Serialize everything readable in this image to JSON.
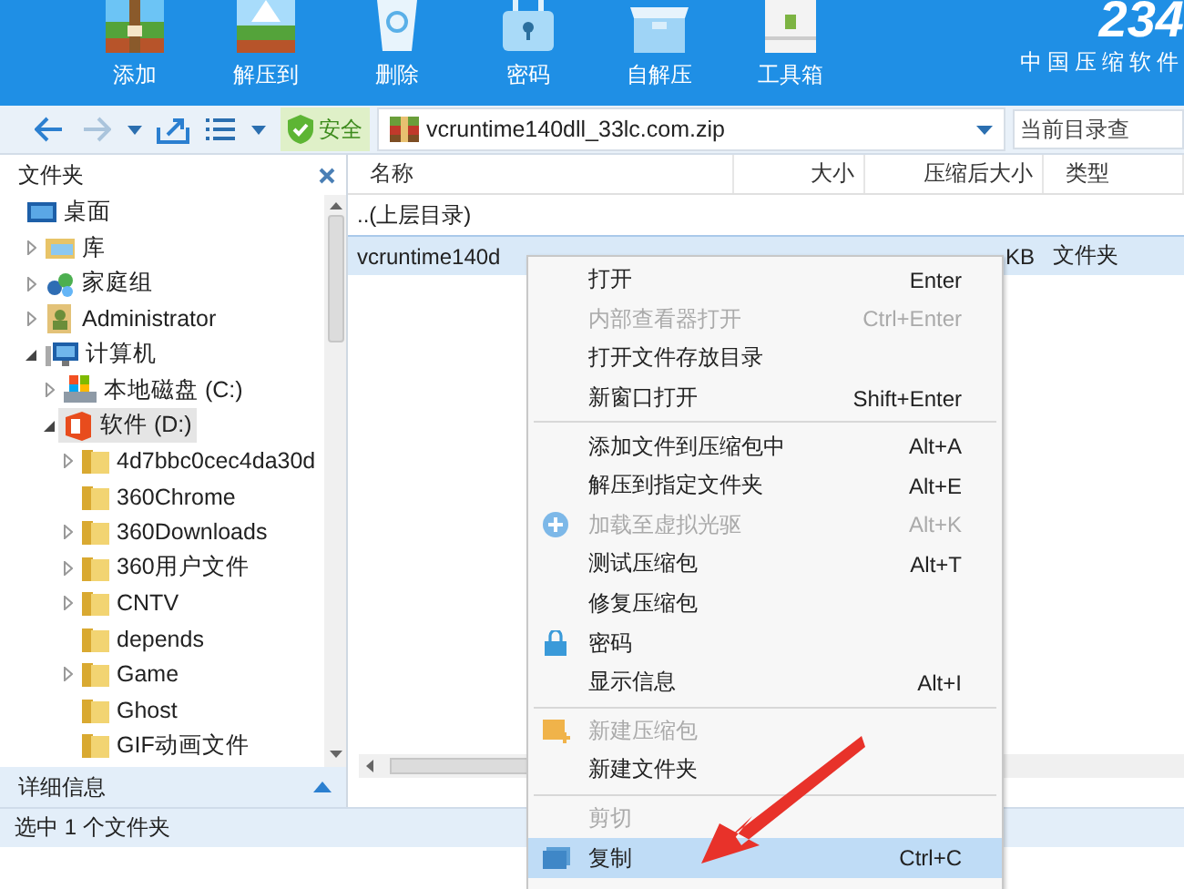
{
  "toolbar": {
    "buttons": [
      {
        "label": "添加",
        "kind": "add"
      },
      {
        "label": "解压到",
        "kind": "extract"
      },
      {
        "label": "删除",
        "kind": "delete"
      },
      {
        "label": "密码",
        "kind": "lock"
      },
      {
        "label": "自解压",
        "kind": "box"
      },
      {
        "label": "工具箱",
        "kind": "tools"
      }
    ],
    "logo": "234",
    "slogan": "中国压缩软件"
  },
  "address_bar": {
    "security": "安全",
    "path": "vcruntime140dll_33lc.com.zip",
    "search": {
      "placeholder": "当前目录查"
    }
  },
  "folder_pane": {
    "title": "文件夹",
    "tree": [
      {
        "label": "桌面",
        "kind": "desktop",
        "selected": false,
        "children": [
          {
            "label": "库",
            "kind": "library",
            "expanded": false,
            "selected": false
          },
          {
            "label": "家庭组",
            "kind": "homegroup",
            "expanded": false,
            "selected": false
          },
          {
            "label": "Administrator",
            "kind": "user",
            "expanded": false,
            "selected": false
          },
          {
            "label": "计算机",
            "kind": "computer",
            "expanded": true,
            "selected": false,
            "children": [
              {
                "label": "本地磁盘 (C:)",
                "kind": "drive",
                "expanded": false,
                "selected": false
              },
              {
                "label": "软件 (D:)",
                "kind": "office-drive",
                "expanded": true,
                "selected": true,
                "children": [
                  {
                    "label": "4d7bbc0cec4da30d",
                    "kind": "folder",
                    "expanded": false,
                    "selected": false
                  },
                  {
                    "label": "360Chrome",
                    "kind": "folder",
                    "selected": false
                  },
                  {
                    "label": "360Downloads",
                    "kind": "folder",
                    "expanded": false,
                    "selected": false
                  },
                  {
                    "label": "360用户文件",
                    "kind": "folder",
                    "expanded": false,
                    "selected": false
                  },
                  {
                    "label": "CNTV",
                    "kind": "folder",
                    "expanded": false,
                    "selected": false
                  },
                  {
                    "label": "depends",
                    "kind": "folder",
                    "selected": false
                  },
                  {
                    "label": "Game",
                    "kind": "folder",
                    "expanded": false,
                    "selected": false
                  },
                  {
                    "label": "Ghost",
                    "kind": "folder",
                    "selected": false
                  },
                  {
                    "label": "GIF动画文件",
                    "kind": "folder",
                    "selected": false
                  }
                ]
              }
            ]
          }
        ]
      }
    ],
    "details": "详细信息"
  },
  "file_table": {
    "columns": [
      "名称",
      "大小",
      "压缩后大小",
      "类型"
    ],
    "rows": [
      {
        "name": "..(上层目录)",
        "selected": false
      },
      {
        "name": "vcruntime140d",
        "compressed": "KB",
        "type": "文件夹",
        "selected": true
      }
    ]
  },
  "context_menu": [
    {
      "kind": "item",
      "label": "打开",
      "shortcut": "Enter",
      "disabled": false,
      "selected": false
    },
    {
      "kind": "item",
      "label": "内部查看器打开",
      "shortcut": "Ctrl+Enter",
      "disabled": true,
      "selected": false
    },
    {
      "kind": "item",
      "label": "打开文件存放目录",
      "disabled": false,
      "selected": false
    },
    {
      "kind": "item",
      "label": "新窗口打开",
      "shortcut": "Shift+Enter",
      "disabled": false,
      "selected": false
    },
    {
      "kind": "separator"
    },
    {
      "kind": "item",
      "label": "添加文件到压缩包中",
      "shortcut": "Alt+A",
      "disabled": false,
      "selected": false
    },
    {
      "kind": "item",
      "label": "解压到指定文件夹",
      "shortcut": "Alt+E",
      "disabled": false,
      "selected": false
    },
    {
      "kind": "item",
      "label": "加载至虚拟光驱",
      "shortcut": "Alt+K",
      "disabled": true,
      "selected": false
    },
    {
      "kind": "item",
      "label": "测试压缩包",
      "shortcut": "Alt+T",
      "disabled": false,
      "selected": false
    },
    {
      "kind": "item",
      "label": "修复压缩包",
      "disabled": false,
      "selected": false
    },
    {
      "kind": "item",
      "label": "密码",
      "disabled": false,
      "selected": false
    },
    {
      "kind": "item",
      "label": "显示信息",
      "shortcut": "Alt+I",
      "disabled": false,
      "selected": false
    },
    {
      "kind": "separator"
    },
    {
      "kind": "item",
      "label": "新建压缩包",
      "disabled": true,
      "selected": false
    },
    {
      "kind": "item",
      "label": "新建文件夹",
      "disabled": false,
      "selected": false
    },
    {
      "kind": "separator"
    },
    {
      "kind": "item",
      "label": "剪切",
      "disabled": true,
      "selected": false
    },
    {
      "kind": "item",
      "label": "复制",
      "shortcut": "Ctrl+C",
      "disabled": false,
      "selected": true
    }
  ],
  "status_bar": "选中 1 个文件夹"
}
